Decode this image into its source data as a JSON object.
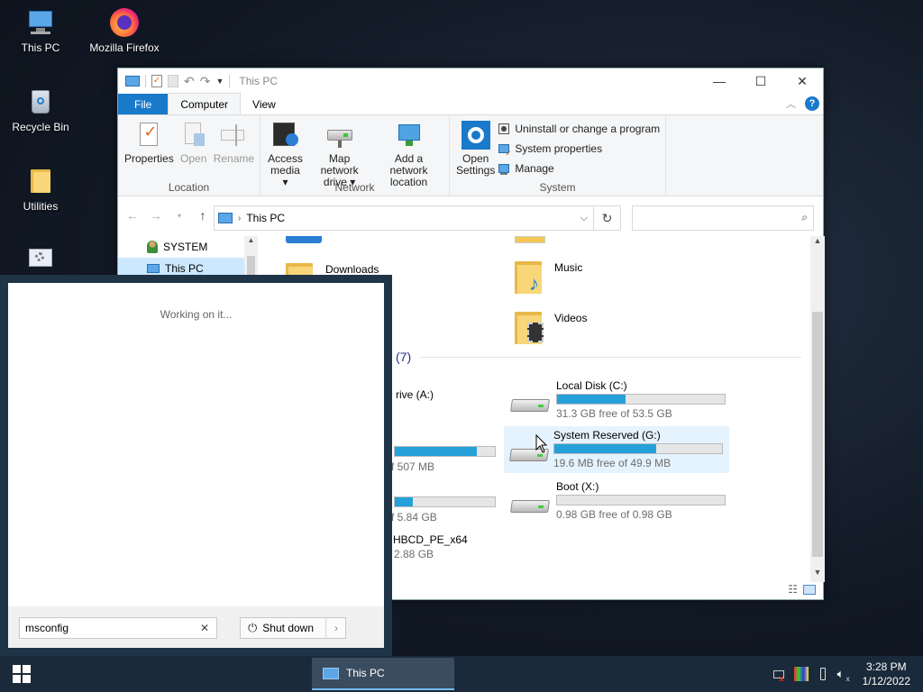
{
  "desktop": {
    "icons": [
      {
        "label": "This PC"
      },
      {
        "label": "Mozilla Firefox"
      },
      {
        "label": "Recycle Bin"
      },
      {
        "label": "Utilities"
      }
    ]
  },
  "explorer": {
    "title": "This PC",
    "tabs": {
      "file": "File",
      "computer": "Computer",
      "view": "View"
    },
    "ribbon": {
      "location": {
        "label": "Location",
        "properties": "Properties",
        "open": "Open",
        "rename": "Rename"
      },
      "network": {
        "label": "Network",
        "access_media_1": "Access",
        "access_media_2": "media",
        "map_drive_1": "Map network",
        "map_drive_2": "drive",
        "add_location_1": "Add a network",
        "add_location_2": "location"
      },
      "system": {
        "label": "System",
        "open_settings_1": "Open",
        "open_settings_2": "Settings",
        "uninstall": "Uninstall or change a program",
        "system_properties": "System properties",
        "manage": "Manage"
      }
    },
    "address": {
      "crumb": "This PC",
      "search_placeholder": ""
    },
    "navpane": [
      {
        "label": "SYSTEM"
      },
      {
        "label": "This PC"
      }
    ],
    "folders": [
      {
        "name": "Downloads"
      },
      {
        "name": "Music"
      },
      {
        "name": "Videos"
      }
    ],
    "devices_header": "(7)",
    "partial_items": {
      "drive_a": "rive (A:)",
      "drive_b_free": "f 507 MB",
      "drive_c2_free": "f 5.84 GB",
      "hbcd_name": "HBCD_PE_x64",
      "hbcd_free": "2.88 GB"
    },
    "drives": [
      {
        "name": "Local Disk (C:)",
        "free": "31.3 GB free of 53.5 GB",
        "used_fraction": 0.41
      },
      {
        "name": "System Reserved (G:)",
        "free": "19.6 MB free of 49.9 MB",
        "used_fraction": 0.61
      },
      {
        "name": "Boot (X:)",
        "free": "0.98 GB free of 0.98 GB",
        "used_fraction": 0.0
      }
    ],
    "partial_bars": [
      0.82,
      0.18
    ]
  },
  "startpanel": {
    "message": "Working on it...",
    "search_value": "msconfig",
    "shutdown_label": "Shut down"
  },
  "taskbar": {
    "active_item": "This PC",
    "time": "3:28 PM",
    "date": "1/12/2022"
  },
  "colors": {
    "accent": "#1979ca",
    "drive_bar": "#26a0da",
    "taskbar": "#1b2a3a"
  }
}
